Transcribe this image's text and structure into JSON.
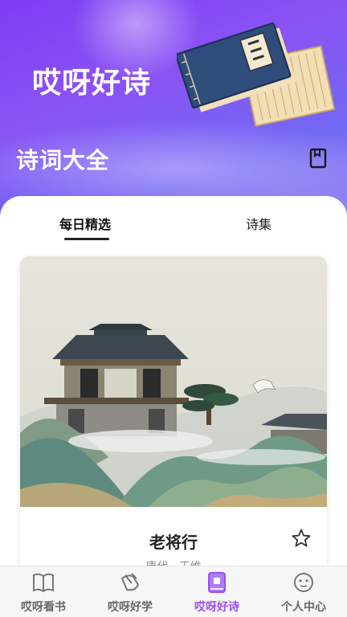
{
  "header": {
    "app_title": "哎呀好诗",
    "section_title": "诗词大全",
    "bookmark_icon": "bookmark-icon",
    "illustration_icon": "ancient-book-icon",
    "accent_color": "#8a52f5"
  },
  "tabs": [
    {
      "label": "每日精选",
      "active": true
    },
    {
      "label": "诗集",
      "active": false
    }
  ],
  "featured_poem": {
    "title": "老将行",
    "meta": "唐代 · 王维",
    "image_icon": "pavilion-landscape-painting",
    "favorite_icon": "star-outline-icon"
  },
  "bottom_nav": {
    "active_color": "#9b4bf0",
    "items": [
      {
        "label": "哎呀看书",
        "icon": "open-book-icon"
      },
      {
        "label": "哎呀好学",
        "icon": "pen-icon"
      },
      {
        "label": "哎呀好诗",
        "icon": "poem-book-icon"
      },
      {
        "label": "个人中心",
        "icon": "face-icon"
      }
    ]
  }
}
